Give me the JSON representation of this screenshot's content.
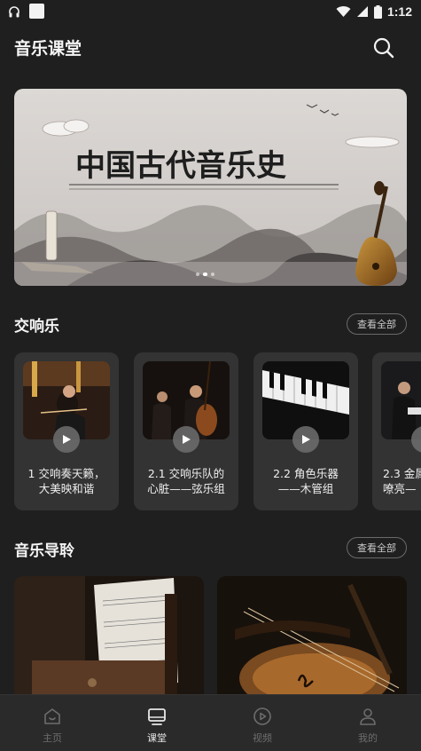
{
  "status_bar": {
    "time": "1:12"
  },
  "header": {
    "title": "音乐课堂"
  },
  "banner": {
    "title": "中国古代音乐史",
    "active_slide": 1,
    "slide_count": 3
  },
  "symphony": {
    "title": "交响乐",
    "more_label": "查看全部",
    "courses": [
      {
        "line1": "1 交响奏天籁，",
        "line2": "大美映和谐"
      },
      {
        "line1": "2.1 交响乐队的",
        "line2": "心脏——弦乐组"
      },
      {
        "line1": "2.2 角色乐器",
        "line2": "——木管组"
      },
      {
        "line1": "2.3 金属",
        "line2": "嘹亮—"
      }
    ]
  },
  "guide": {
    "title": "音乐导聆",
    "more_label": "查看全部"
  },
  "tabs": [
    {
      "label": "主页",
      "icon": "home-icon",
      "active": false
    },
    {
      "label": "课堂",
      "icon": "classroom-icon",
      "active": true
    },
    {
      "label": "视频",
      "icon": "video-icon",
      "active": false
    },
    {
      "label": "我的",
      "icon": "profile-icon",
      "active": false
    }
  ],
  "colors": {
    "background": "#1f1f1f",
    "card": "#333333",
    "tab_bar": "#2a2a2a",
    "accent_text": "#f5f5f5",
    "inactive_tab": "#6d6d6d"
  }
}
